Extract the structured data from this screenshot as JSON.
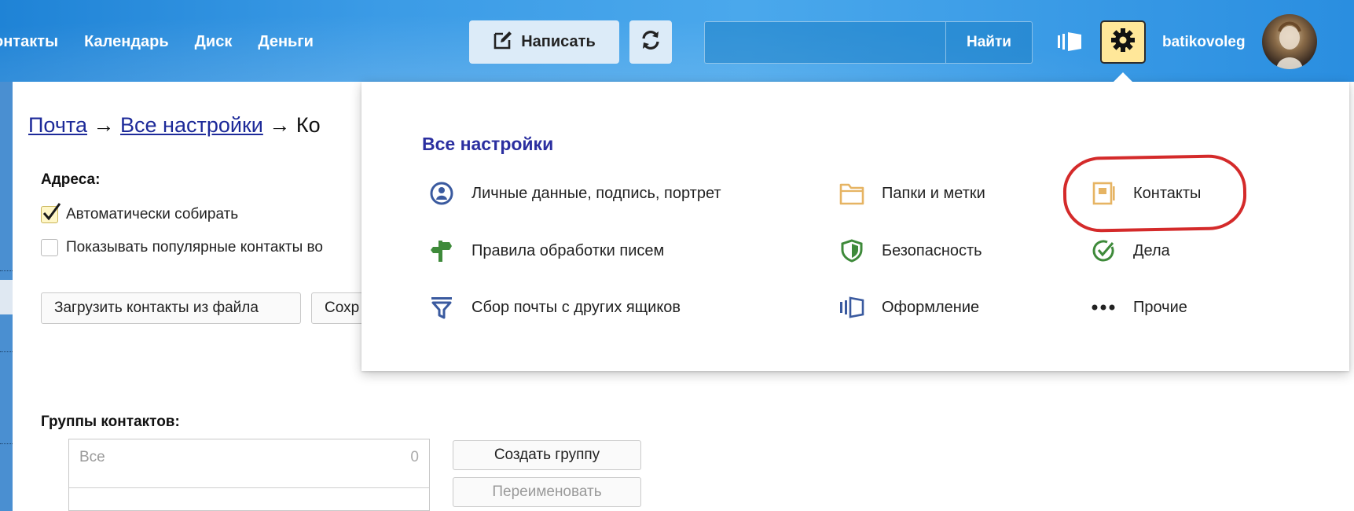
{
  "header": {
    "nav": [
      "онтакты",
      "Календарь",
      "Диск",
      "Деньги"
    ],
    "compose_label": "Написать",
    "search_placeholder": "",
    "search_button": "Найти",
    "username": "batikovoleg"
  },
  "content": {
    "breadcrumb": {
      "mail": "Почта",
      "all_settings": "Все настройки",
      "current": "Ко"
    },
    "addresses_title": "Адреса:",
    "auto_collect_label": "Автоматически собирать",
    "auto_collect_checked": true,
    "popular_contacts_label": "Показывать популярные контакты во",
    "popular_contacts_checked": false,
    "upload_button": "Загрузить контакты из файла",
    "save_button": "Сохр",
    "groups_title": "Группы контактов:",
    "groups": [
      {
        "name": "Все",
        "count": "0"
      }
    ],
    "create_group_button": "Создать группу",
    "rename_button": "Переименовать"
  },
  "dropdown": {
    "title": "Все настройки",
    "items": [
      {
        "label": "Личные данные, подпись, портрет",
        "icon": "person-circle-icon"
      },
      {
        "label": "Правила обработки писем",
        "icon": "signpost-icon"
      },
      {
        "label": "Сбор почты с других ящиков",
        "icon": "funnel-icon"
      },
      {
        "label": "Папки и метки",
        "icon": "folder-icon"
      },
      {
        "label": "Безопасность",
        "icon": "shield-icon"
      },
      {
        "label": "Оформление",
        "icon": "theme-icon"
      },
      {
        "label": "Контакты",
        "icon": "contacts-icon"
      },
      {
        "label": "Дела",
        "icon": "check-circle-icon"
      },
      {
        "label": "Прочие",
        "icon": "more-dots-icon"
      }
    ]
  },
  "colors": {
    "header_blue": "#3b9be6",
    "dropdown_title": "#2b2fa0",
    "highlight_red": "#d42a2a",
    "gear_bg": "#ffe799"
  }
}
